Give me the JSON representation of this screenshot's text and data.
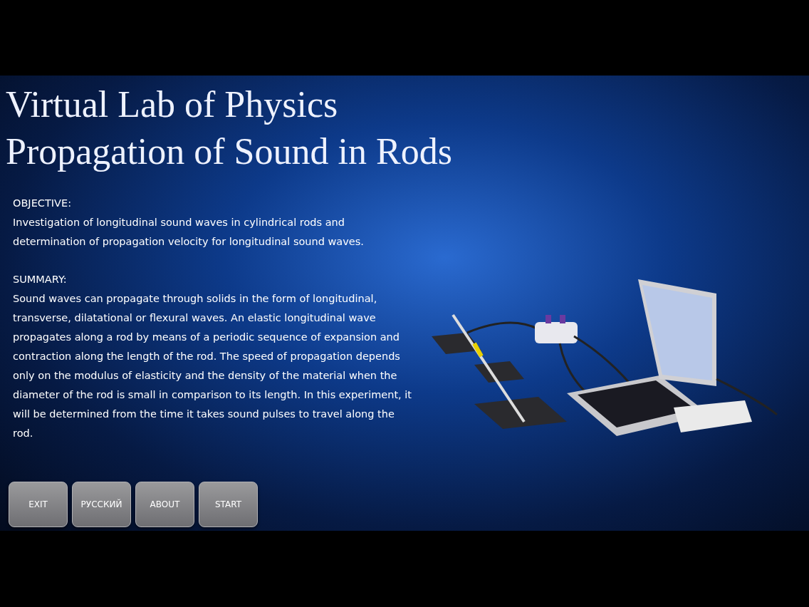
{
  "title_lines": [
    "Virtual Lab of Physics",
    "Propagation of Sound in Rods"
  ],
  "sections": [
    {
      "heading": "OBJECTIVE:",
      "text": "Investigation of longitudinal sound waves in cylindrical rods and determination of propagation velocity for longitudinal sound waves."
    },
    {
      "heading": "SUMMARY:",
      "text": "Sound waves can propagate through solids in the form of longitudinal, transverse, dilatational or flexural waves. An elastic longitudinal wave propagates along a rod by means of a periodic sequence of expansion and contraction along the length of the rod. The speed of propagation depends only on the modulus of elasticity and the density of the material when the diameter of the rod is small in comparison to its length. In this experiment, it will be determined from the time it takes sound pulses to travel along the rod."
    }
  ],
  "buttons": [
    "EXIT",
    "РУССКИЙ",
    "ABOUT",
    "START"
  ]
}
